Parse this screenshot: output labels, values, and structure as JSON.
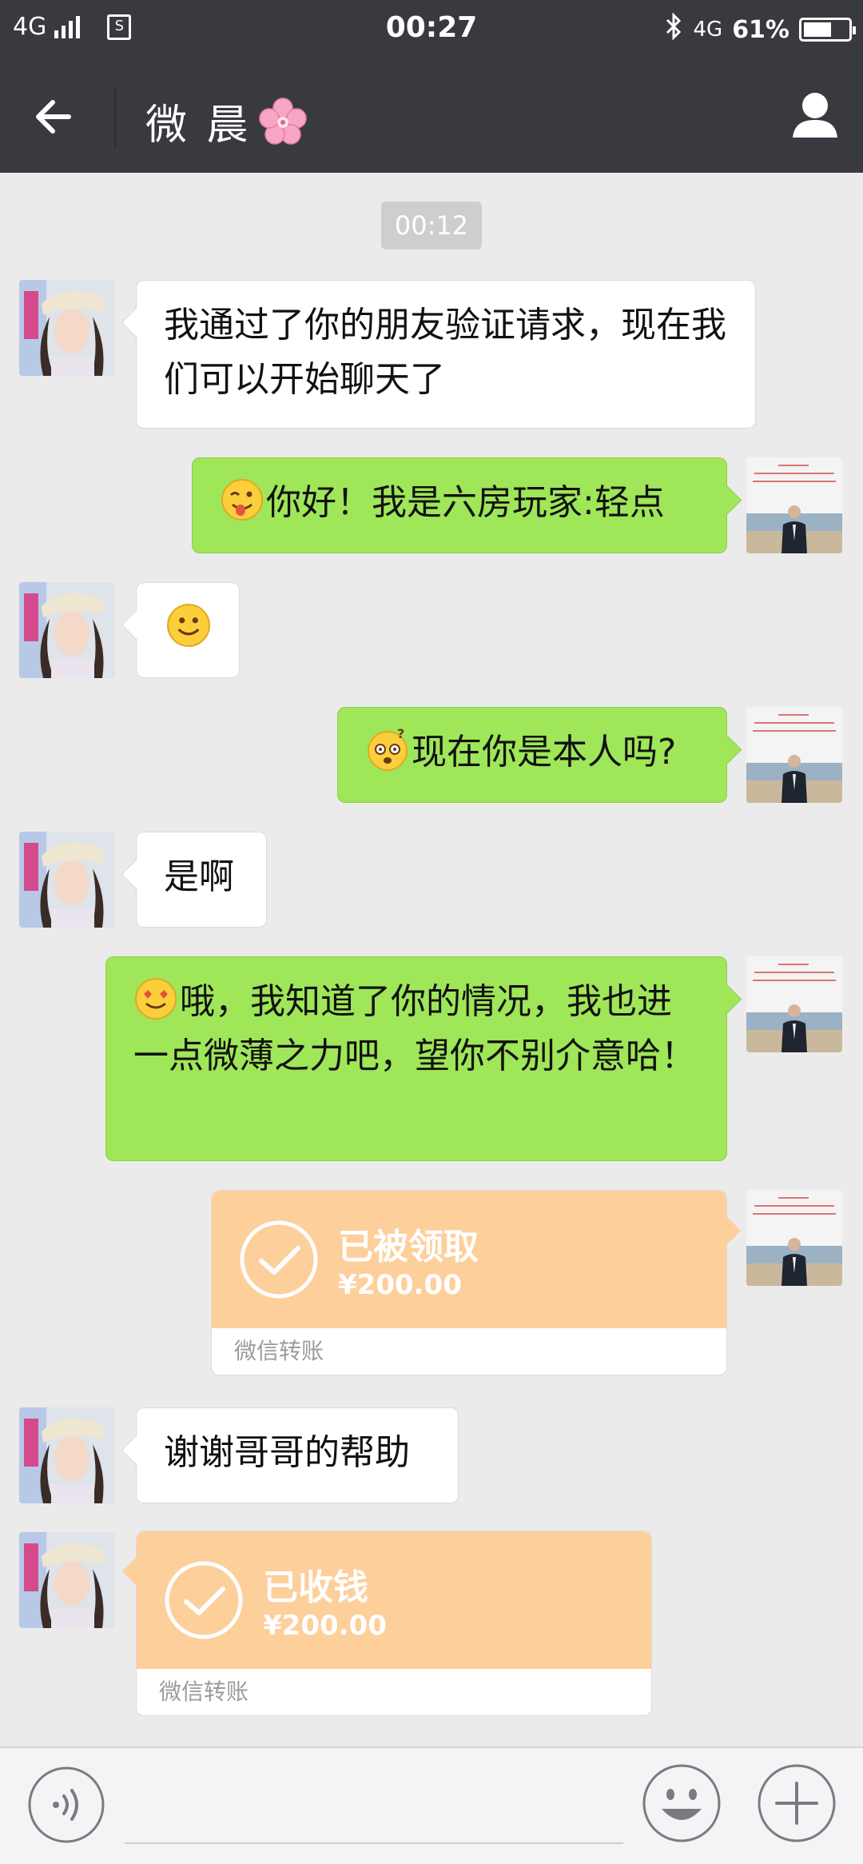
{
  "status_bar": {
    "network_left": "4G",
    "time": "00:27",
    "network_right": "4G",
    "battery": "61%",
    "sim_icon": "S"
  },
  "header": {
    "title": "微 晨",
    "title_emoji": "cherry-blossom-icon"
  },
  "chat": {
    "timestamp": "00:12",
    "messages": [
      {
        "side": "in",
        "type": "text",
        "text": "我通过了你的朋友验证请求，现在我们可以开始聊天了"
      },
      {
        "side": "out",
        "type": "text",
        "emoji": "winking-tongue-emoji",
        "text": "你好！我是六房玩家:轻点"
      },
      {
        "side": "in",
        "type": "emoji",
        "emoji": "smile-emoji"
      },
      {
        "side": "out",
        "type": "text",
        "emoji": "confused-emoji",
        "text": "现在你是本人吗?"
      },
      {
        "side": "in",
        "type": "text",
        "text": "是啊"
      },
      {
        "side": "out",
        "type": "text",
        "emoji": "heart-eyes-emoji",
        "text": "哦，我知道了你的情况，我也进一点微薄之力吧，望你不别介意哈！"
      },
      {
        "side": "out",
        "type": "transfer",
        "status": "已被领取",
        "amount": "¥200.00",
        "footer": "微信转账"
      },
      {
        "side": "in",
        "type": "text",
        "text": "谢谢哥哥的帮助"
      },
      {
        "side": "in",
        "type": "transfer",
        "status": "已收钱",
        "amount": "¥200.00",
        "footer": "微信转账"
      }
    ]
  },
  "input_bar": {
    "voice_icon": "voice-icon",
    "emoji_icon": "emoji-face-icon",
    "plus_icon": "plus-icon"
  },
  "colors": {
    "header_bg": "#393a3f",
    "chat_bg": "#ebebeb",
    "outgoing_bubble": "#9fe658",
    "transfer_card": "#fdcf9b"
  }
}
